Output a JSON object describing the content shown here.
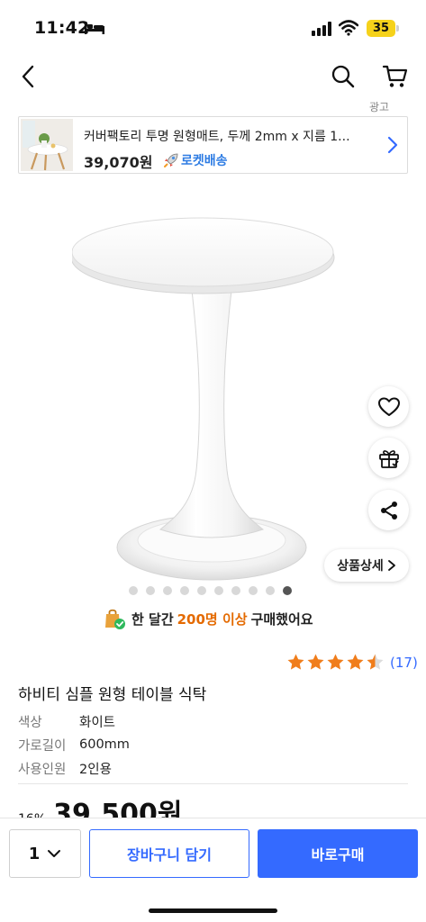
{
  "status_bar": {
    "time": "11:42",
    "battery": "35"
  },
  "nav": {
    "back_icon": "chevron-left-icon",
    "search_icon": "search-icon",
    "cart_icon": "cart-icon"
  },
  "ad": {
    "label": "광고",
    "title": "커버팩토리 투명 원형매트, 두께 2mm x 지름 1...",
    "price": "39,070원",
    "badge": "로켓배송",
    "badge_color": "#2e7ce3"
  },
  "product_image": {
    "buttons": {
      "like_icon": "heart-icon",
      "gift_icon": "gift-icon",
      "share_icon": "share-icon"
    },
    "detail_button": "상품상세",
    "dot_count": 10,
    "active_dot": 9
  },
  "purchase_info": {
    "prefix": "한 달간",
    "highlight": "200명 이상",
    "suffix": "구매했어요",
    "highlight_color": "#e46a00"
  },
  "rating": {
    "stars": 4.5,
    "reviews": "(17)",
    "star_color": "#f07d1b"
  },
  "product": {
    "title": "하비티 심플 원형 테이블 식탁",
    "options": [
      {
        "label": "색상",
        "value": "화이트"
      },
      {
        "label": "가로길이",
        "value": "600mm"
      },
      {
        "label": "사용인원",
        "value": "2인용"
      }
    ],
    "discount": "16%",
    "price": "39,500원"
  },
  "bottom_bar": {
    "quantity": "1",
    "cart_button": "장바구니 담기",
    "buy_button": "바로구매",
    "accent_color": "#346aff"
  }
}
